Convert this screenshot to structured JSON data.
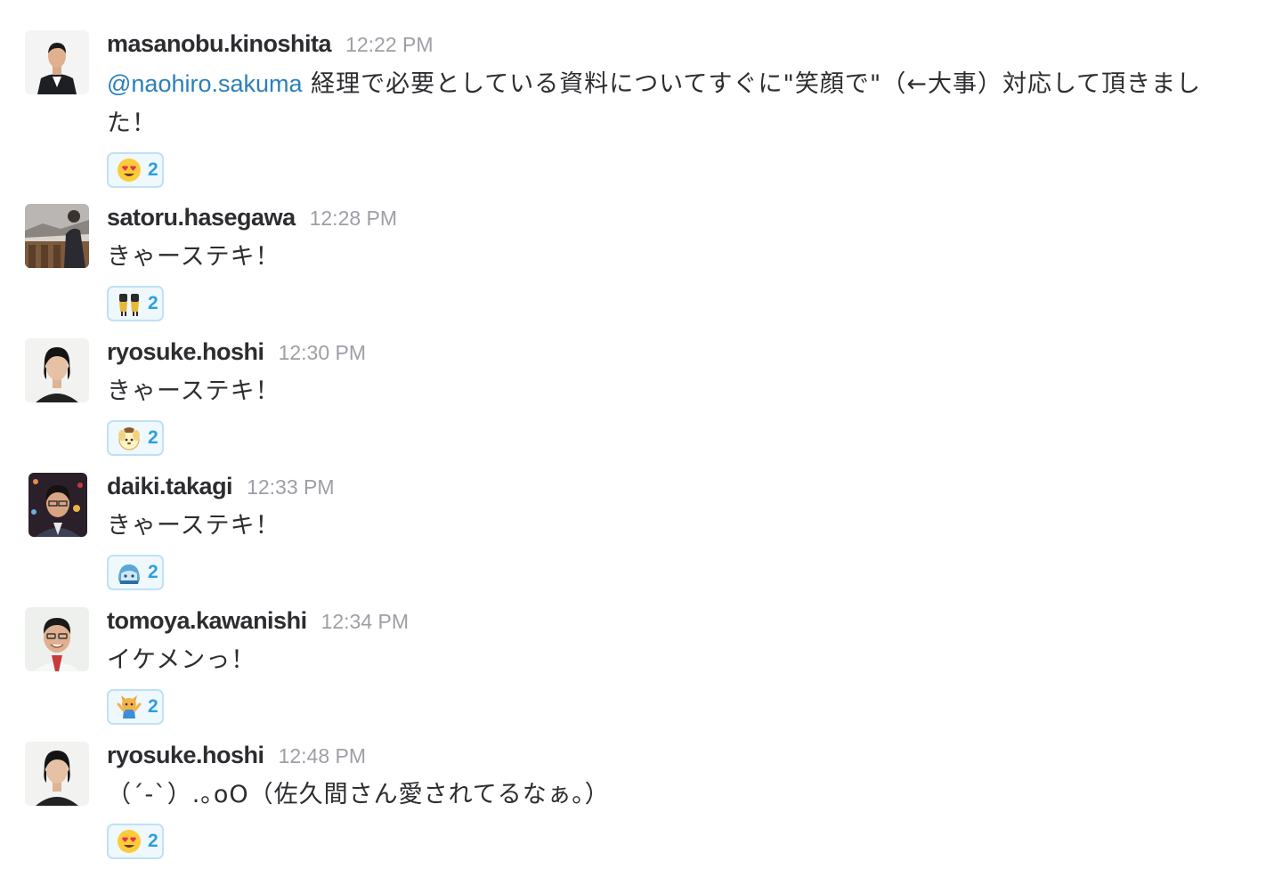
{
  "messages": [
    {
      "sender": "masanobu.kinoshita",
      "time": "12:22 PM",
      "mention": "@naohiro.sakuma",
      "text": " 経理で必要としている資料についてすぐに\"笑顔で\"（←大事）対応して頂きました！",
      "reaction": {
        "emoji": "heart-eyes-emoji",
        "count": "2"
      }
    },
    {
      "sender": "satoru.hasegawa",
      "time": "12:28 PM",
      "mention": "",
      "text": "きゃーステキ！",
      "reaction": {
        "emoji": "dancers-emoji",
        "count": "2"
      }
    },
    {
      "sender": "ryosuke.hoshi",
      "time": "12:30 PM",
      "mention": "",
      "text": "きゃーステキ！",
      "reaction": {
        "emoji": "pompom-dog-emoji",
        "count": "2"
      }
    },
    {
      "sender": "daiki.takagi",
      "time": "12:33 PM",
      "mention": "",
      "text": "きゃーステキ！",
      "reaction": {
        "emoji": "blue-character-emoji",
        "count": "2"
      }
    },
    {
      "sender": "tomoya.kawanishi",
      "time": "12:34 PM",
      "mention": "",
      "text": "イケメンっ！",
      "reaction": {
        "emoji": "cheering-cat-emoji",
        "count": "2"
      }
    },
    {
      "sender": "ryosuke.hoshi",
      "time": "12:48 PM",
      "mention": "",
      "text": "（´-`）.｡oO（佐久間さん愛されてるなぁ。）",
      "reaction": {
        "emoji": "heart-eyes-emoji",
        "count": "2"
      }
    }
  ],
  "colors": {
    "mention": "#2a80b9",
    "timestamp": "#9e9ea6",
    "reaction_border": "#bfe1f4",
    "reaction_bg": "#eef8fd",
    "reaction_count": "#2d9ee0"
  }
}
